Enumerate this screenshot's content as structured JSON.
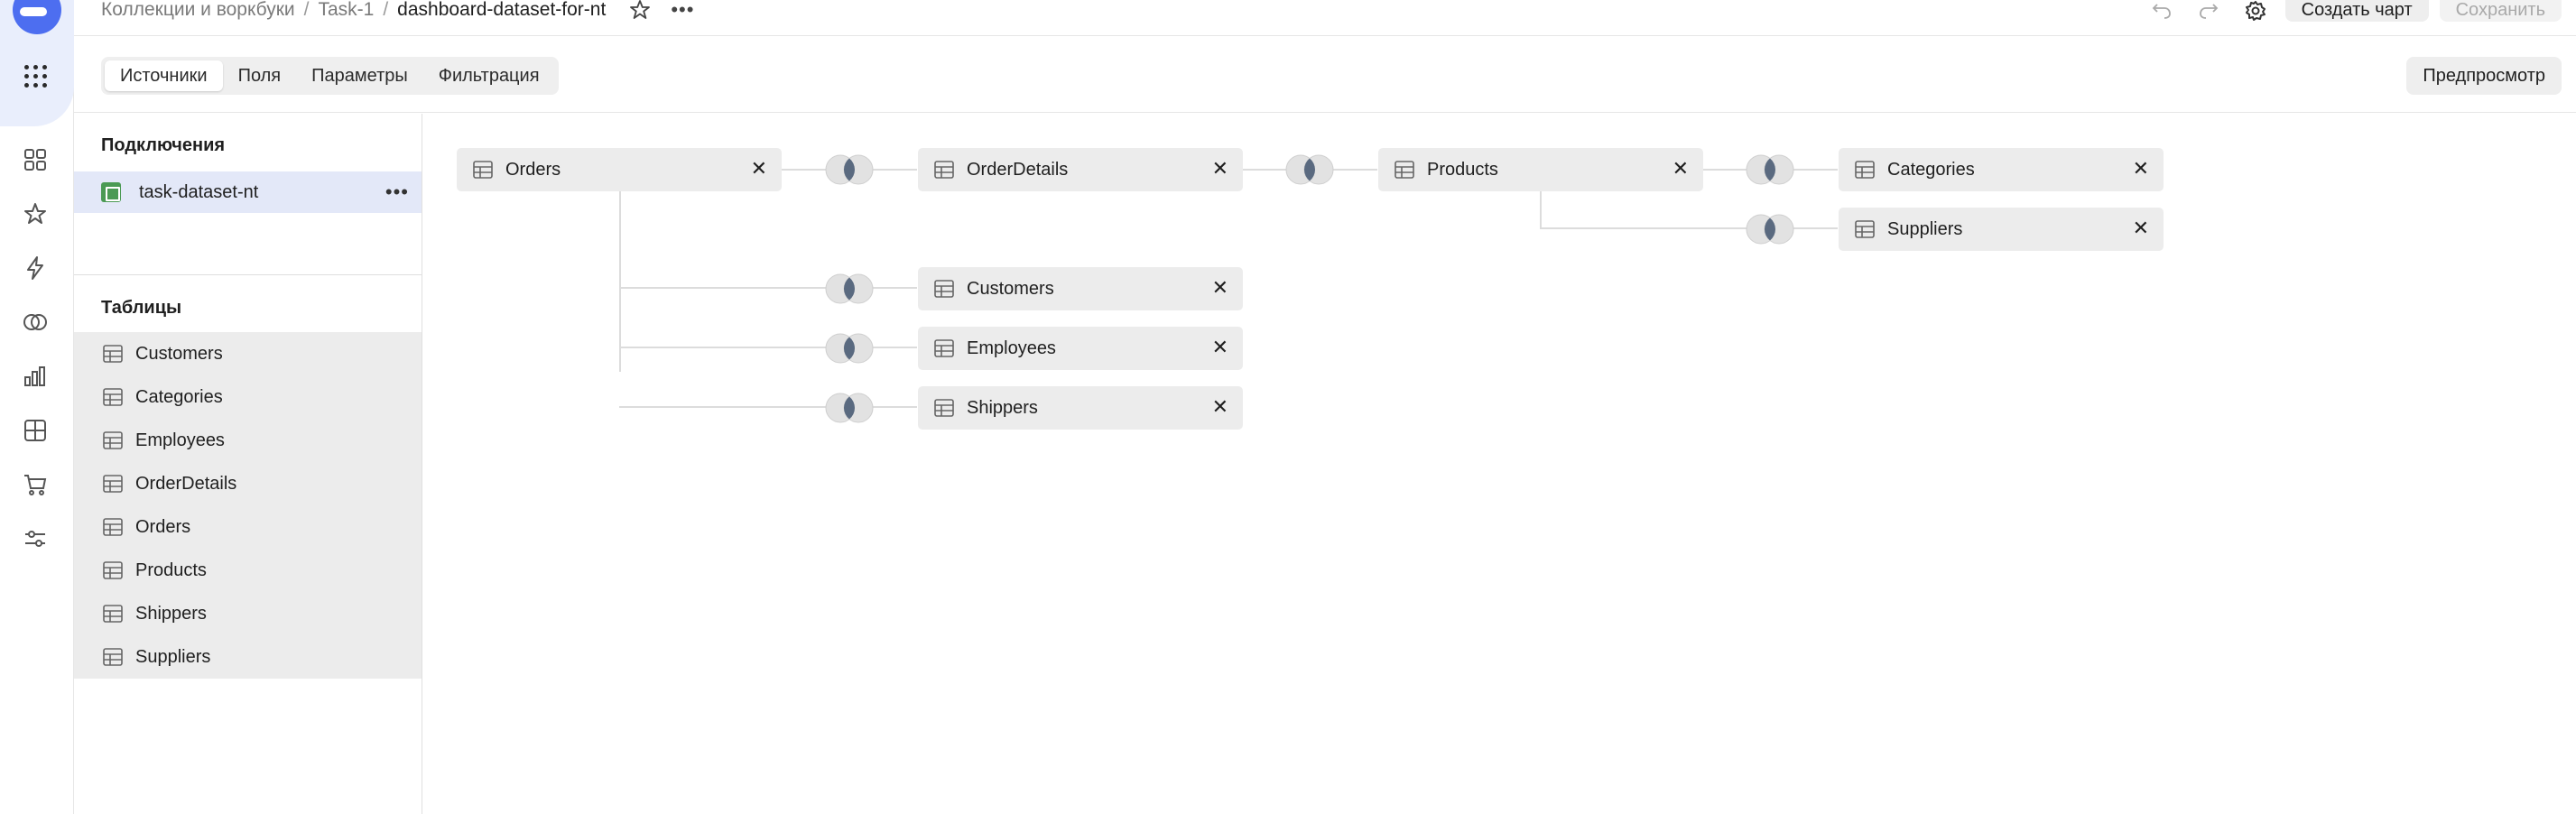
{
  "header": {
    "breadcrumbs": [
      "Коллекции и воркбуки",
      "Task-1"
    ],
    "current": "dashboard-dataset-for-nt",
    "create_chart": "Создать чарт",
    "save": "Сохранить"
  },
  "tabs": [
    "Источники",
    "Поля",
    "Параметры",
    "Фильтрация"
  ],
  "preview": "Предпросмотр",
  "sidebar": {
    "connections_title": "Подключения",
    "connection": "task-dataset-nt",
    "tables_title": "Таблицы",
    "tables": [
      "Customers",
      "Categories",
      "Employees",
      "OrderDetails",
      "Orders",
      "Products",
      "Shippers",
      "Suppliers"
    ]
  },
  "canvas": {
    "nodes": [
      "Orders",
      "OrderDetails",
      "Products",
      "Categories",
      "Suppliers",
      "Customers",
      "Employees",
      "Shippers"
    ]
  },
  "colors": {
    "accent": "#4d6ef0",
    "selected_row": "#e3e8f8",
    "node_bg": "#ececec"
  },
  "icons": [
    "logo",
    "apps-icon",
    "dashboards-icon",
    "star-icon",
    "lightning-icon",
    "datasets-icon",
    "charts-icon",
    "grid-icon",
    "cart-icon",
    "settings-sliders-icon",
    "undo-icon",
    "redo-icon",
    "gear-icon"
  ]
}
